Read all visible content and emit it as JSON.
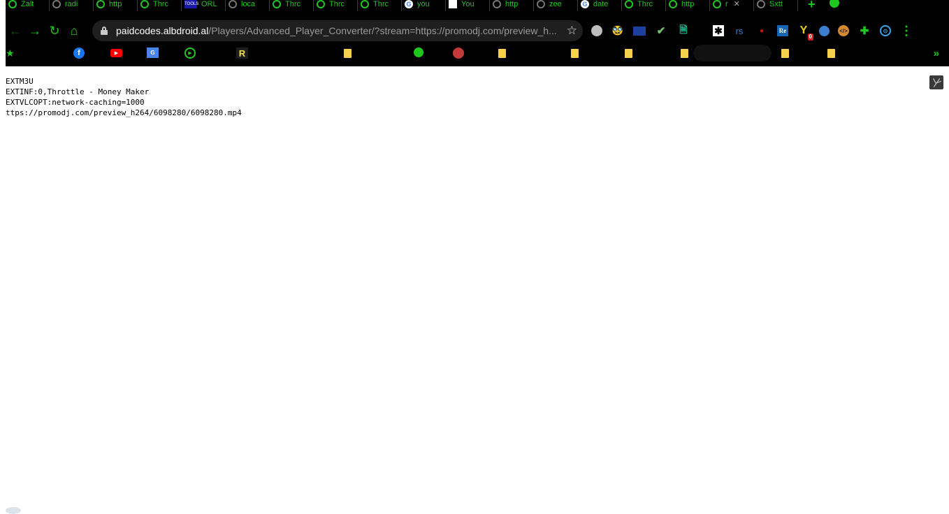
{
  "tabs": [
    {
      "label": "Zalt",
      "fav": "play"
    },
    {
      "label": "radi",
      "fav": "grey"
    },
    {
      "label": "http",
      "fav": "play"
    },
    {
      "label": "Thrc",
      "fav": "play"
    },
    {
      "label": "ORL",
      "fav": "tools"
    },
    {
      "label": "loca",
      "fav": "grey"
    },
    {
      "label": "Thrc",
      "fav": "play"
    },
    {
      "label": "Thrc",
      "fav": "play"
    },
    {
      "label": "Thrc",
      "fav": "play"
    },
    {
      "label": "you",
      "fav": "g"
    },
    {
      "label": "You",
      "fav": "white"
    },
    {
      "label": "http",
      "fav": "grey"
    },
    {
      "label": "zee",
      "fav": "grey"
    },
    {
      "label": "date",
      "fav": "g"
    },
    {
      "label": "Thrc",
      "fav": "play"
    },
    {
      "label": "http",
      "fav": "play"
    },
    {
      "label": "r",
      "fav": "play",
      "close": "✕",
      "active": true
    },
    {
      "label": "Sxtt",
      "fav": "grey"
    }
  ],
  "tools_icon_text": "TOOLS",
  "new_tab_symbol": "+",
  "toolbar": {
    "back": "←",
    "forward": "→",
    "reload": "↻",
    "home": "⌂",
    "url_host": "paidcodes.albdroid.al",
    "url_rest": "/Players/Advanced_Player_Converter/?stream=https://promodj.com/preview_h...",
    "star": "☆"
  },
  "extensions": {
    "mask": "🥸",
    "check": "✔",
    "doc": "🗎",
    "asterisk": "✱",
    "rs": "rs",
    "dot": "●",
    "re": "Re",
    "ya": "Y",
    "ya_badge": "0",
    "code": "</>",
    "puzzle": "✚",
    "ring": "⊙",
    "menu": "⋮"
  },
  "bookmarks": {
    "star": "★",
    "fb": "f",
    "yt": "▶",
    "gt": "G",
    "play": "▶",
    "r": "R",
    "more": "»"
  },
  "content_lines": [
    "EXTM3U",
    "EXTINF:0,Throttle - Money Maker",
    "EXTVLCOPT:network-caching=1000",
    "ttps://promodj.com/preview_h264/6098280/6098280.mp4"
  ],
  "colors": {
    "accent": "#1ec81e",
    "chrome_bg": "#000000",
    "omnibox_bg": "#1f1f1f",
    "page_bg": "#ffffff"
  }
}
